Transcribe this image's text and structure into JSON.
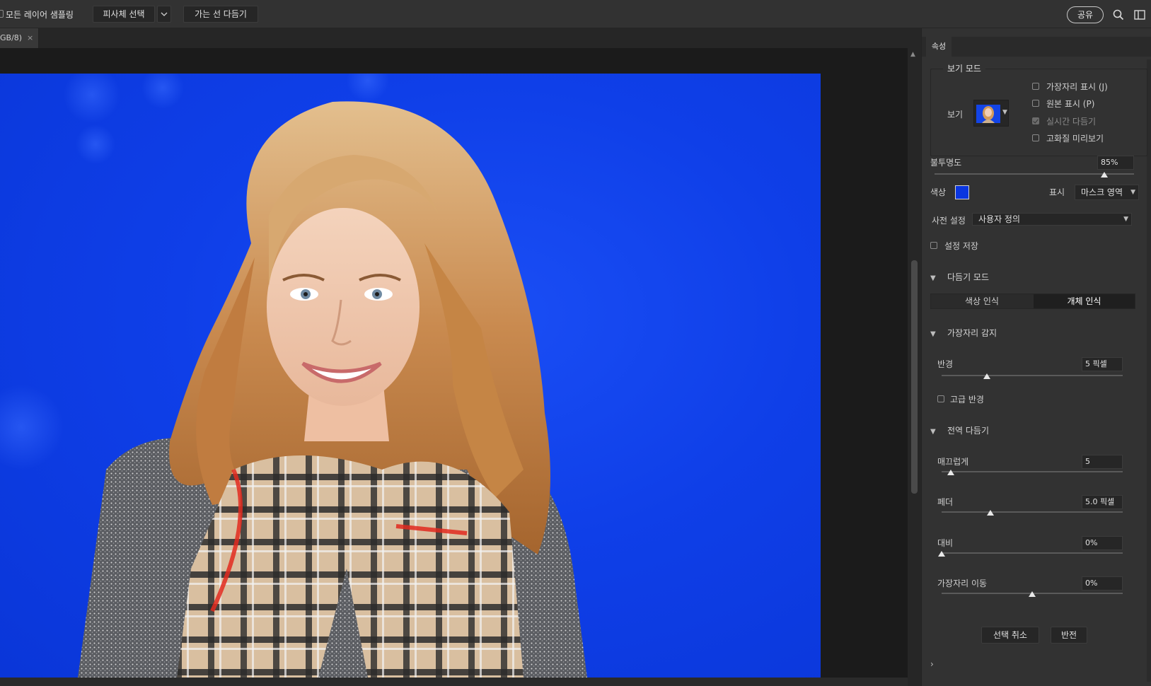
{
  "options_bar": {
    "sample_all_layers_label": "모든 레이어 샘플링",
    "select_subject_label": "피사체 선택",
    "refine_hair_label": "가는 선 다듬기",
    "share_label": "공유"
  },
  "document_tab": {
    "title": "GB/8)",
    "close_glyph": "×"
  },
  "properties": {
    "tab_label": "속성",
    "view_mode": {
      "legend": "보기 모드",
      "view_label": "보기",
      "show_edge": "가장자리 표시 (J)",
      "show_original": "원본 표시 (P)",
      "realtime_refine": "실시간 다듬기",
      "high_quality_preview": "고화질 미리보기",
      "show_edge_checked": false,
      "show_original_checked": false,
      "realtime_refine_checked": true,
      "high_quality_preview_checked": false
    },
    "opacity": {
      "label": "불투명도",
      "value": "85%",
      "level": 0.85
    },
    "color": {
      "label": "색상",
      "swatch": "#0a36e0"
    },
    "display": {
      "label": "표시",
      "value": "마스크 영역"
    },
    "preset": {
      "label": "사전 설정",
      "value": "사용자 정의"
    },
    "remember_settings": {
      "label": "설정 저장",
      "checked": false
    },
    "refine_mode": {
      "title": "다듬기 모드",
      "color_aware": "색상 인식",
      "object_aware": "개체 인식",
      "active": "object_aware"
    },
    "edge_detection": {
      "title": "가장자리 감지",
      "radius_label": "반경",
      "radius_value": "5 픽셀",
      "radius_level": 0.25,
      "smart_radius_label": "고급 반경",
      "smart_radius_checked": false
    },
    "global_refinements": {
      "title": "전역 다듬기",
      "smooth_label": "매끄럽게",
      "smooth_value": "5",
      "smooth_level": 0.05,
      "feather_label": "페더",
      "feather_value": "5.0 픽셀",
      "feather_level": 0.27,
      "contrast_label": "대비",
      "contrast_value": "0%",
      "contrast_level": 0.0,
      "shift_edge_label": "가장자리 이동",
      "shift_edge_value": "0%",
      "shift_edge_level": 0.5
    },
    "clear_selection_label": "선택 취소",
    "invert_label": "반전",
    "output_chevron": "›"
  }
}
